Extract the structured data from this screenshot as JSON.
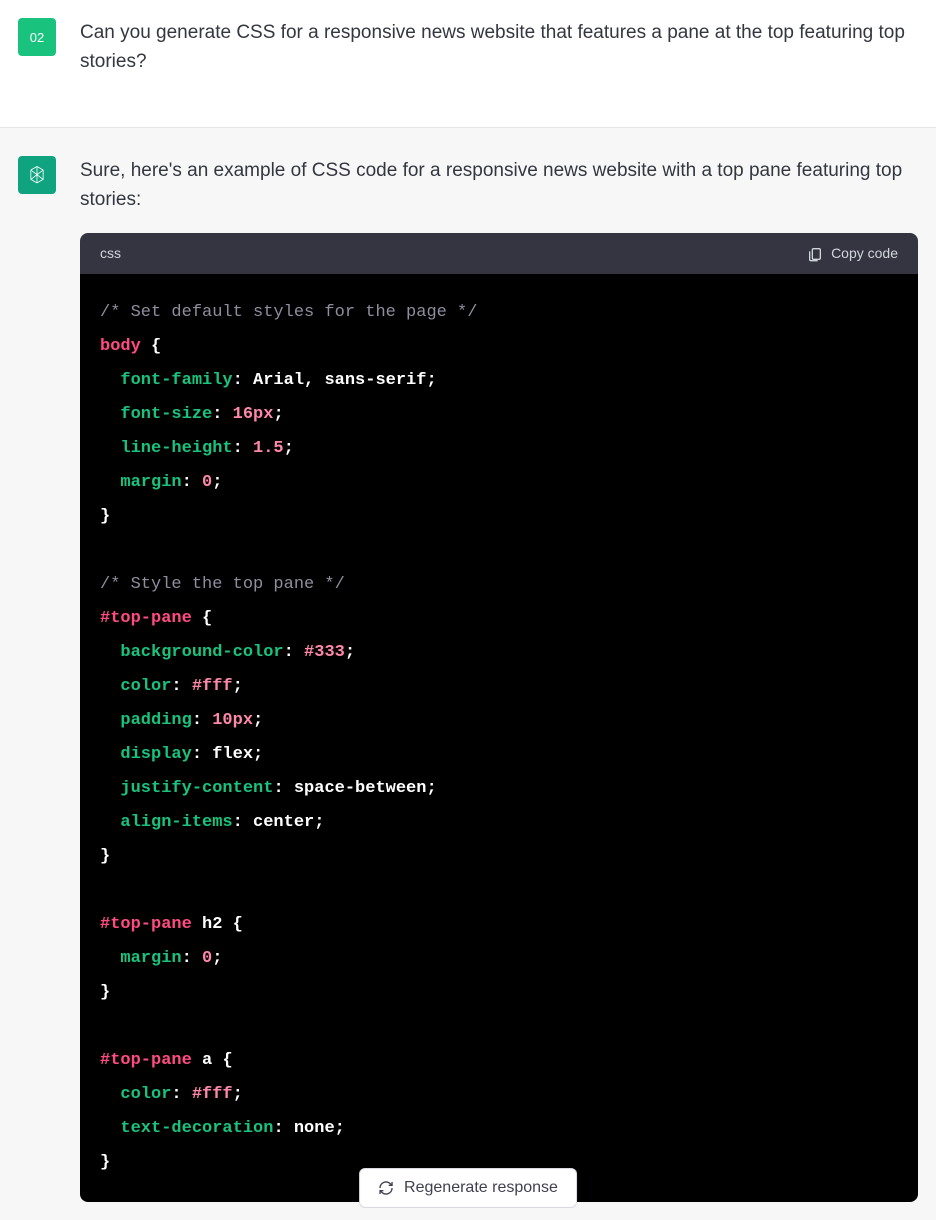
{
  "user": {
    "avatar_label": "02",
    "question": "Can you generate CSS for a responsive news website that features a pane at the top featuring top stories?"
  },
  "assistant": {
    "intro": "Sure, here's an example of CSS code for a responsive news website with a top pane featuring top stories:"
  },
  "code": {
    "language_label": "css",
    "copy_label": "Copy code",
    "tokens": [
      {
        "cls": "c-cmt",
        "t": "/* Set default styles for the page */"
      },
      {
        "br": 1
      },
      {
        "cls": "c-sel",
        "t": "body"
      },
      {
        "cls": "c-brace",
        "t": " {"
      },
      {
        "br": 1
      },
      {
        "cls": "c-val",
        "t": "  "
      },
      {
        "cls": "c-prop",
        "t": "font-family"
      },
      {
        "cls": "c-val",
        "t": ": Arial, sans-serif;"
      },
      {
        "br": 1
      },
      {
        "cls": "c-val",
        "t": "  "
      },
      {
        "cls": "c-prop",
        "t": "font-size"
      },
      {
        "cls": "c-val",
        "t": ": "
      },
      {
        "cls": "c-num",
        "t": "16px"
      },
      {
        "cls": "c-val",
        "t": ";"
      },
      {
        "br": 1
      },
      {
        "cls": "c-val",
        "t": "  "
      },
      {
        "cls": "c-prop",
        "t": "line-height"
      },
      {
        "cls": "c-val",
        "t": ": "
      },
      {
        "cls": "c-num",
        "t": "1.5"
      },
      {
        "cls": "c-val",
        "t": ";"
      },
      {
        "br": 1
      },
      {
        "cls": "c-val",
        "t": "  "
      },
      {
        "cls": "c-prop",
        "t": "margin"
      },
      {
        "cls": "c-val",
        "t": ": "
      },
      {
        "cls": "c-num",
        "t": "0"
      },
      {
        "cls": "c-val",
        "t": ";"
      },
      {
        "br": 1
      },
      {
        "cls": "c-brace",
        "t": "}"
      },
      {
        "br": 1
      },
      {
        "br": 1
      },
      {
        "cls": "c-cmt",
        "t": "/* Style the top pane */"
      },
      {
        "br": 1
      },
      {
        "cls": "c-sel",
        "t": "#top-pane"
      },
      {
        "cls": "c-brace",
        "t": " {"
      },
      {
        "br": 1
      },
      {
        "cls": "c-val",
        "t": "  "
      },
      {
        "cls": "c-prop",
        "t": "background-color"
      },
      {
        "cls": "c-val",
        "t": ": "
      },
      {
        "cls": "c-num",
        "t": "#333"
      },
      {
        "cls": "c-val",
        "t": ";"
      },
      {
        "br": 1
      },
      {
        "cls": "c-val",
        "t": "  "
      },
      {
        "cls": "c-prop",
        "t": "color"
      },
      {
        "cls": "c-val",
        "t": ": "
      },
      {
        "cls": "c-num",
        "t": "#fff"
      },
      {
        "cls": "c-val",
        "t": ";"
      },
      {
        "br": 1
      },
      {
        "cls": "c-val",
        "t": "  "
      },
      {
        "cls": "c-prop",
        "t": "padding"
      },
      {
        "cls": "c-val",
        "t": ": "
      },
      {
        "cls": "c-num",
        "t": "10px"
      },
      {
        "cls": "c-val",
        "t": ";"
      },
      {
        "br": 1
      },
      {
        "cls": "c-val",
        "t": "  "
      },
      {
        "cls": "c-prop",
        "t": "display"
      },
      {
        "cls": "c-val",
        "t": ": flex;"
      },
      {
        "br": 1
      },
      {
        "cls": "c-val",
        "t": "  "
      },
      {
        "cls": "c-prop",
        "t": "justify-content"
      },
      {
        "cls": "c-val",
        "t": ": space-between;"
      },
      {
        "br": 1
      },
      {
        "cls": "c-val",
        "t": "  "
      },
      {
        "cls": "c-prop",
        "t": "align-items"
      },
      {
        "cls": "c-val",
        "t": ": center;"
      },
      {
        "br": 1
      },
      {
        "cls": "c-brace",
        "t": "}"
      },
      {
        "br": 1
      },
      {
        "br": 1
      },
      {
        "cls": "c-sel",
        "t": "#top-pane"
      },
      {
        "cls": "c-val",
        "t": " h2 "
      },
      {
        "cls": "c-brace",
        "t": "{"
      },
      {
        "br": 1
      },
      {
        "cls": "c-val",
        "t": "  "
      },
      {
        "cls": "c-prop",
        "t": "margin"
      },
      {
        "cls": "c-val",
        "t": ": "
      },
      {
        "cls": "c-num",
        "t": "0"
      },
      {
        "cls": "c-val",
        "t": ";"
      },
      {
        "br": 1
      },
      {
        "cls": "c-brace",
        "t": "}"
      },
      {
        "br": 1
      },
      {
        "br": 1
      },
      {
        "cls": "c-sel",
        "t": "#top-pane"
      },
      {
        "cls": "c-val",
        "t": " a "
      },
      {
        "cls": "c-brace",
        "t": "{"
      },
      {
        "br": 1
      },
      {
        "cls": "c-val",
        "t": "  "
      },
      {
        "cls": "c-prop",
        "t": "color"
      },
      {
        "cls": "c-val",
        "t": ": "
      },
      {
        "cls": "c-num",
        "t": "#fff"
      },
      {
        "cls": "c-val",
        "t": ";"
      },
      {
        "br": 1
      },
      {
        "cls": "c-val",
        "t": "  "
      },
      {
        "cls": "c-prop",
        "t": "text-decoration"
      },
      {
        "cls": "c-val",
        "t": ": none;"
      },
      {
        "br": 1
      },
      {
        "cls": "c-brace",
        "t": "}"
      }
    ]
  },
  "regenerate_label": "Regenerate response"
}
